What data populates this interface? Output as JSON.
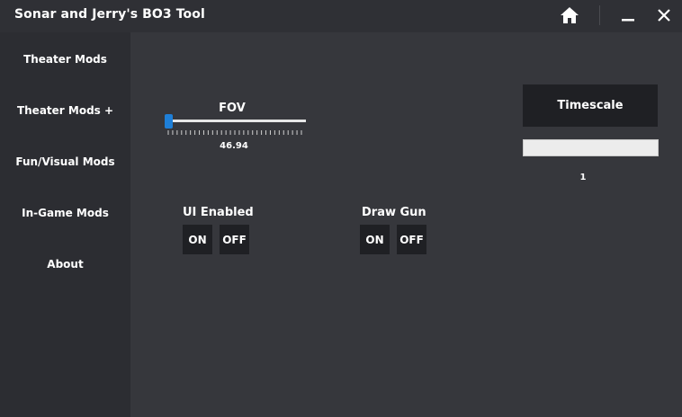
{
  "window": {
    "title": "Sonar and Jerry's BO3 Tool",
    "icons": {
      "home": "home-icon",
      "minimize": "minimize-icon",
      "close": "close-icon"
    }
  },
  "sidebar": {
    "items": [
      {
        "label": "Theater Mods"
      },
      {
        "label": "Theater Mods +"
      },
      {
        "label": "Fun/Visual Mods"
      },
      {
        "label": "In-Game Mods"
      },
      {
        "label": "About"
      }
    ]
  },
  "fov": {
    "label": "FOV",
    "value": "46.94",
    "level": 0.0
  },
  "toggles": [
    {
      "label": "UI Enabled",
      "on": "ON",
      "off": "OFF"
    },
    {
      "label": "Draw Gun",
      "on": "ON",
      "off": "OFF"
    }
  ],
  "timescale": {
    "button_label": "Timescale",
    "input_value": "",
    "value": "1"
  },
  "colors": {
    "background": "#36373c",
    "sidebar": "#2c2d32",
    "titlebar": "#2f3035",
    "button": "#1f2024",
    "accent": "#1e7fd8"
  }
}
